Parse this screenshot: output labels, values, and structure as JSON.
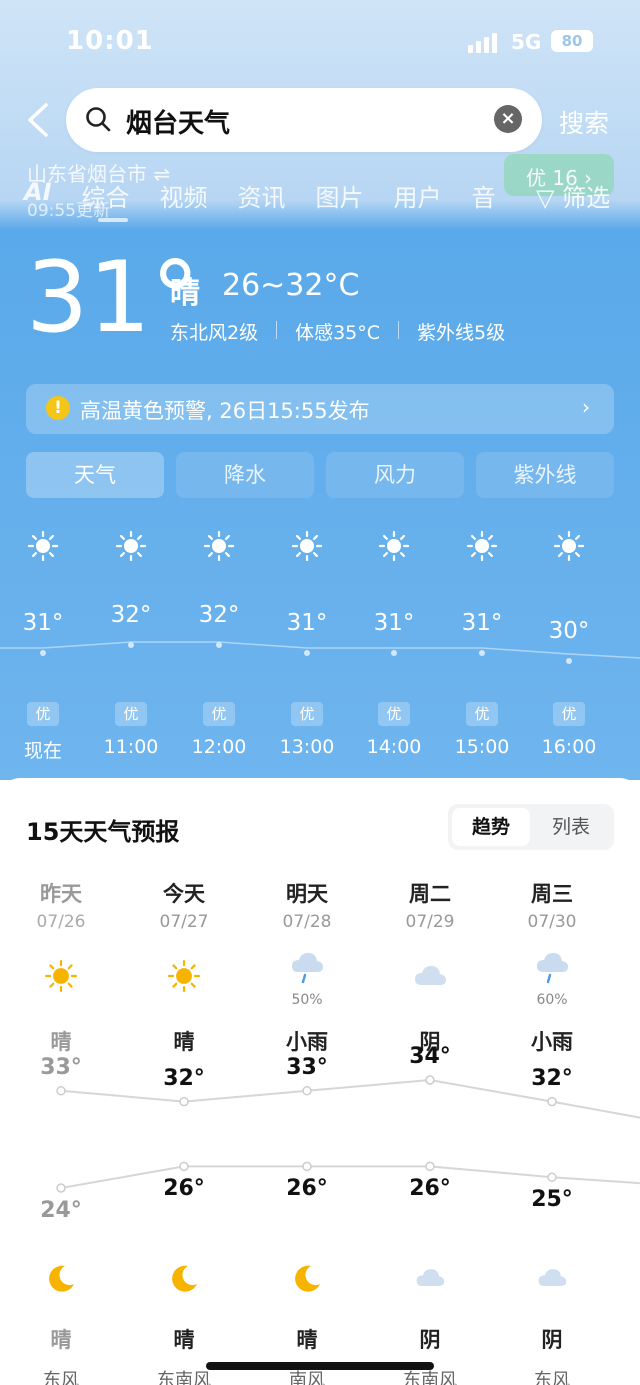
{
  "status": {
    "time": "10:01",
    "network": "5G",
    "battery": "80"
  },
  "search": {
    "query": "烟台天气",
    "clear_icon": "×",
    "submit_label": "搜索"
  },
  "location": {
    "name": "山东省烟台市 ⇌",
    "updated": "09:55更新"
  },
  "tabs": [
    "AI",
    "综合",
    "视频",
    "资讯",
    "图片",
    "用户",
    "音"
  ],
  "aqi_pill": "优 16 ›",
  "filter_label": "▽ 筛选",
  "current": {
    "temp": "31°",
    "condition": "晴",
    "range": "26~32°C",
    "wind": "东北风2级",
    "feels": "体感35°C",
    "uv": "紫外线5级"
  },
  "alert": {
    "icon": "!",
    "text": "高温黄色预警, 26日15:55发布",
    "chevron": "›"
  },
  "hourly_tabs": [
    "天气",
    "降水",
    "风力",
    "紫外线"
  ],
  "hourly": [
    {
      "temp": "31°",
      "aqi": "优",
      "time": "现在"
    },
    {
      "temp": "32°",
      "aqi": "优",
      "time": "11:00"
    },
    {
      "temp": "32°",
      "aqi": "优",
      "time": "12:00"
    },
    {
      "temp": "31°",
      "aqi": "优",
      "time": "13:00"
    },
    {
      "temp": "31°",
      "aqi": "优",
      "time": "14:00"
    },
    {
      "temp": "31°",
      "aqi": "优",
      "time": "15:00"
    },
    {
      "temp": "30°",
      "aqi": "优",
      "time": "16:00"
    }
  ],
  "forecast": {
    "title": "15天天气预报",
    "toggle": [
      "趋势",
      "列表"
    ],
    "days": [
      {
        "name": "昨天",
        "date": "07/26",
        "day_icon": "sun",
        "pct": "",
        "day_cond": "晴",
        "hi": "33°",
        "lo": "24°",
        "night_icon": "moon",
        "night_cond": "晴",
        "wind": "东风"
      },
      {
        "name": "今天",
        "date": "07/27",
        "day_icon": "sun",
        "pct": "",
        "day_cond": "晴",
        "hi": "32°",
        "lo": "26°",
        "night_icon": "moon",
        "night_cond": "晴",
        "wind": "东南风"
      },
      {
        "name": "明天",
        "date": "07/28",
        "day_icon": "rain",
        "pct": "50%",
        "day_cond": "小雨",
        "hi": "33°",
        "lo": "26°",
        "night_icon": "moon",
        "night_cond": "晴",
        "wind": "南风"
      },
      {
        "name": "周二",
        "date": "07/29",
        "day_icon": "cloud",
        "pct": "",
        "day_cond": "阴",
        "hi": "34°",
        "lo": "26°",
        "night_icon": "cloud",
        "night_cond": "阴",
        "wind": "东南风"
      },
      {
        "name": "周三",
        "date": "07/30",
        "day_icon": "rain",
        "pct": "60%",
        "day_cond": "小雨",
        "hi": "32°",
        "lo": "25°",
        "night_icon": "cloud",
        "night_cond": "阴",
        "wind": "东风"
      }
    ]
  },
  "colors": {
    "sky": "#5aa9ea",
    "sun": "#f6b400",
    "alert": "#f5c518"
  }
}
